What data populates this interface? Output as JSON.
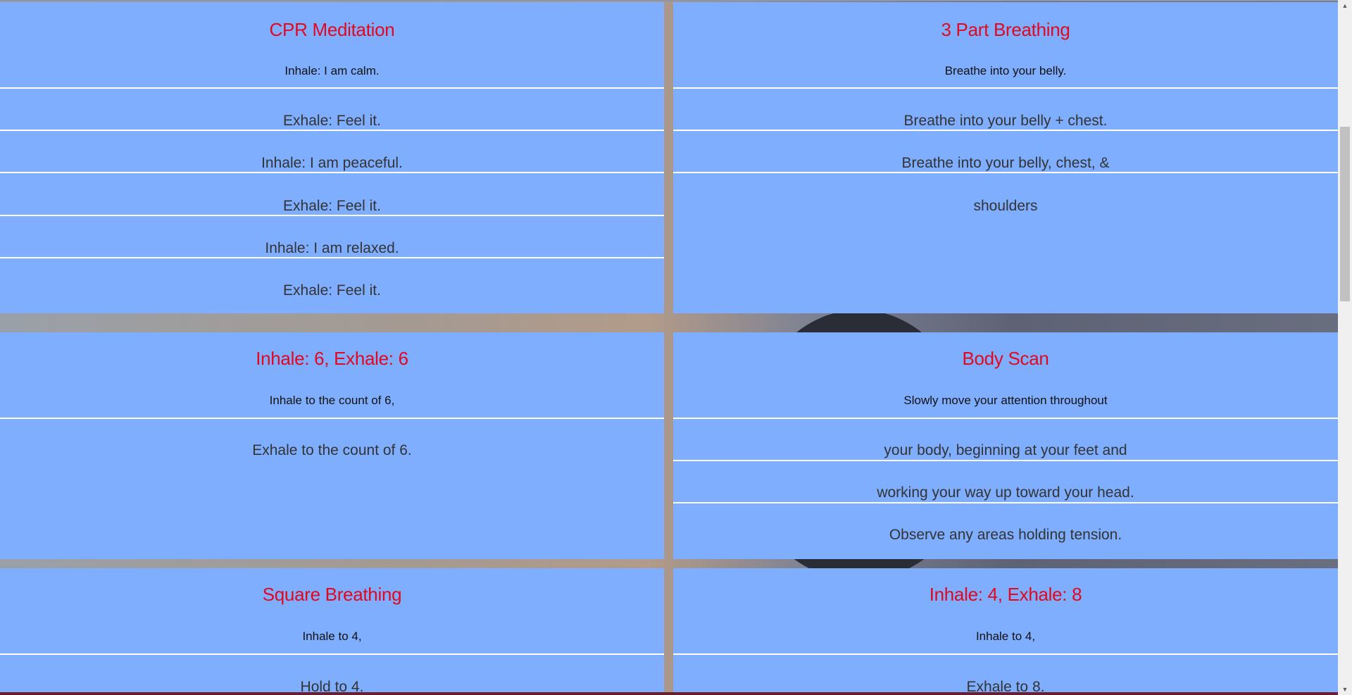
{
  "cards": [
    {
      "title": "CPR Meditation",
      "subtitle": "Inhale: I am calm.",
      "lines": [
        "Exhale: Feel it.",
        "Inhale: I am peaceful.",
        "Exhale: Feel it.",
        "Inhale: I am relaxed.",
        "Exhale: Feel it."
      ]
    },
    {
      "title": "3 Part Breathing",
      "subtitle": "Breathe into your belly.",
      "lines": [
        "Breathe into your belly + chest.",
        "Breathe into your belly, chest, &",
        "shoulders"
      ]
    },
    {
      "title": "Inhale: 6, Exhale: 6",
      "subtitle": "Inhale to the count of 6,",
      "lines": [
        "Exhale to the count of 6."
      ]
    },
    {
      "title": "Body Scan",
      "subtitle": "Slowly move your attention throughout",
      "lines": [
        "your body, beginning at your feet and",
        "working your way up toward your head.",
        "Observe any areas holding tension."
      ]
    },
    {
      "title": "Square Breathing",
      "subtitle": "Inhale to 4,",
      "lines": [
        "Hold to 4."
      ]
    },
    {
      "title": "Inhale: 4, Exhale: 8",
      "subtitle": "Inhale to 4,",
      "lines": [
        "Exhale to 8."
      ]
    }
  ],
  "colors": {
    "card_background": "#7faefe",
    "title": "#e0091d",
    "rule": "#ffffff"
  }
}
